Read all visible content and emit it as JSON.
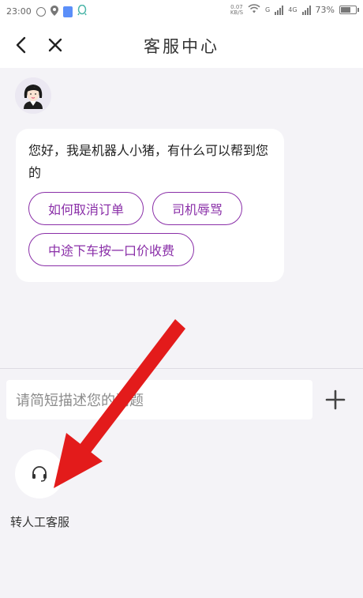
{
  "status_bar": {
    "time": "23:00",
    "net_speed_top": "0.07",
    "net_speed_bottom": "KB/S",
    "sim1_label": "G",
    "sim2_label": "4G",
    "battery_percent": "73%",
    "battery_level": 0.73
  },
  "header": {
    "title": "客服中心"
  },
  "chat": {
    "greeting": "您好，我是机器人小猪，有什么可以帮到您的",
    "quick_replies": [
      "如何取消订单",
      "司机辱骂",
      "中途下车按一口价收费"
    ]
  },
  "input": {
    "placeholder": "请简短描述您的问题"
  },
  "panel": {
    "human_service_label": "转人工客服"
  },
  "colors": {
    "accent_purple": "#8a2fa8",
    "annotation_red": "#e31b1b"
  }
}
